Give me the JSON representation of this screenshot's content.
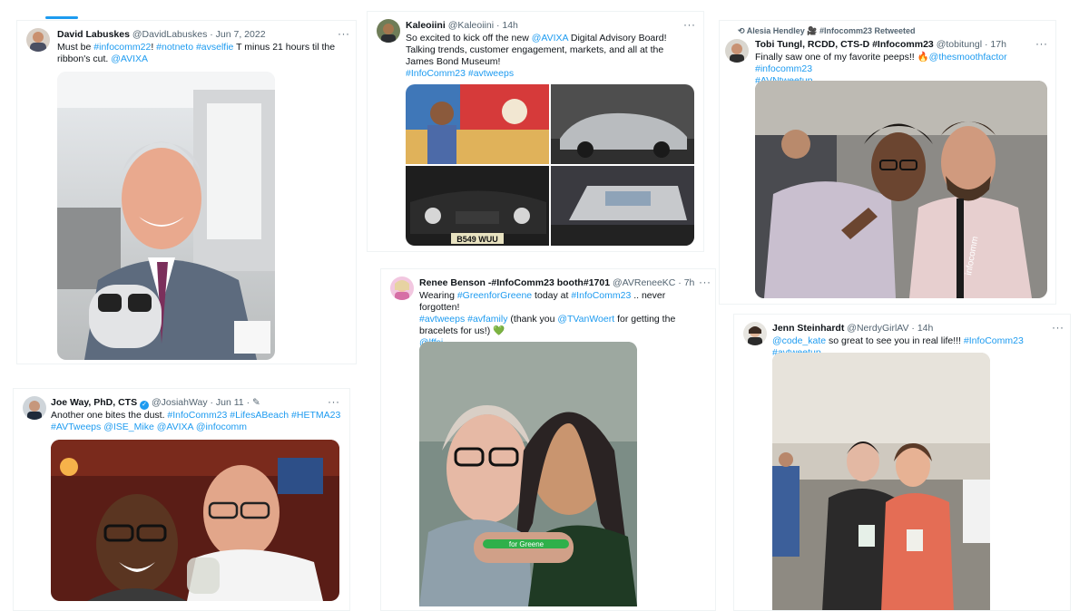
{
  "t1": {
    "name": "David Labuskes",
    "handle": "@DavidLabuskes · Jun 7, 2022",
    "more": "···",
    "w1": "Must be ",
    "l1": "#infocomm22",
    "w2": "!  ",
    "l2": "#notneto",
    "w3": " ",
    "l3": "#avselfie",
    "w4": " T minus 21 hours til the ribbon's cut. ",
    "l4": "@AVIXA",
    "photo_alt": "Selfie with a figurine in an office"
  },
  "t2": {
    "name": "Kaleoiini",
    "handle": "@Kaleoiini · 14h",
    "more": "···",
    "w1": "So excited to kick off the new ",
    "l1": "@AVIXA",
    "w2": " Digital Advisory Board!  Talking trends, customer engagement, markets, and all at the James Bond Museum!",
    "l2": "#InfoComm23",
    "w3": " ",
    "l3": "#avtweeps",
    "plate": "B549 WUU"
  },
  "t3": {
    "rt_label": "Alesia Hendley 🎥 #Infocomm23 Retweeted",
    "name": "Tobi Tungl, RCDD, CTS-D #Infocomm23",
    "handle": "@tobitungl · 17h",
    "more": "···",
    "w1": "Finally saw one of my favorite peeps!! 🔥",
    "l1": "@thesmoothfactor",
    "w2": " ",
    "l2": "#infocomm23",
    "l3": "#AVNtweetup",
    "lanyard": "infocomm"
  },
  "t4": {
    "name": "Renee Benson -#InfoComm23 booth#1701",
    "handle": "@AVReneeKC · 7h",
    "more": "···",
    "w1": "Wearing ",
    "l1": "#GreenforGreene",
    "w2": " today at ",
    "l2": "#InfoComm23",
    "w3": " .. never forgotten! ",
    "l3": "#avtweeps",
    "w4": " ",
    "l4": "#avfamily",
    "w5": " (thank you ",
    "l5": "@TVanWoert",
    "w6": " for getting the bracelets for us!) 💚",
    "l6": "@lffsi",
    "band": "for Greene"
  },
  "t5": {
    "name": "Joe Way, PhD, CTS",
    "verified": "✓",
    "handle": "@JosiahWay · Jun 11 · ✎",
    "more": "···",
    "w1": "Another one bites the dust. ",
    "l1": "#InfoComm23",
    "w2": " ",
    "l2": "#LifesABeach",
    "w3": " ",
    "l3": "#HETMA23",
    "l4": "#AVTweeps",
    "w4": " ",
    "l5": "@ISE_Mike",
    "w5": " ",
    "l6": "@AVIXA",
    "w6": " ",
    "l7": "@infocomm"
  },
  "t6": {
    "name": "Jenn Steinhardt",
    "handle": "@NerdyGirlAV · 14h",
    "more": "···",
    "l1": "@code_kate",
    "w1": " so great to see you in real life!!! ",
    "l2": "#InfoComm23",
    "w2": " ",
    "l3": "#avtweetup"
  },
  "colors": {
    "accent": "#1d9bf0",
    "text": "#0f1419",
    "muted": "#536471"
  }
}
